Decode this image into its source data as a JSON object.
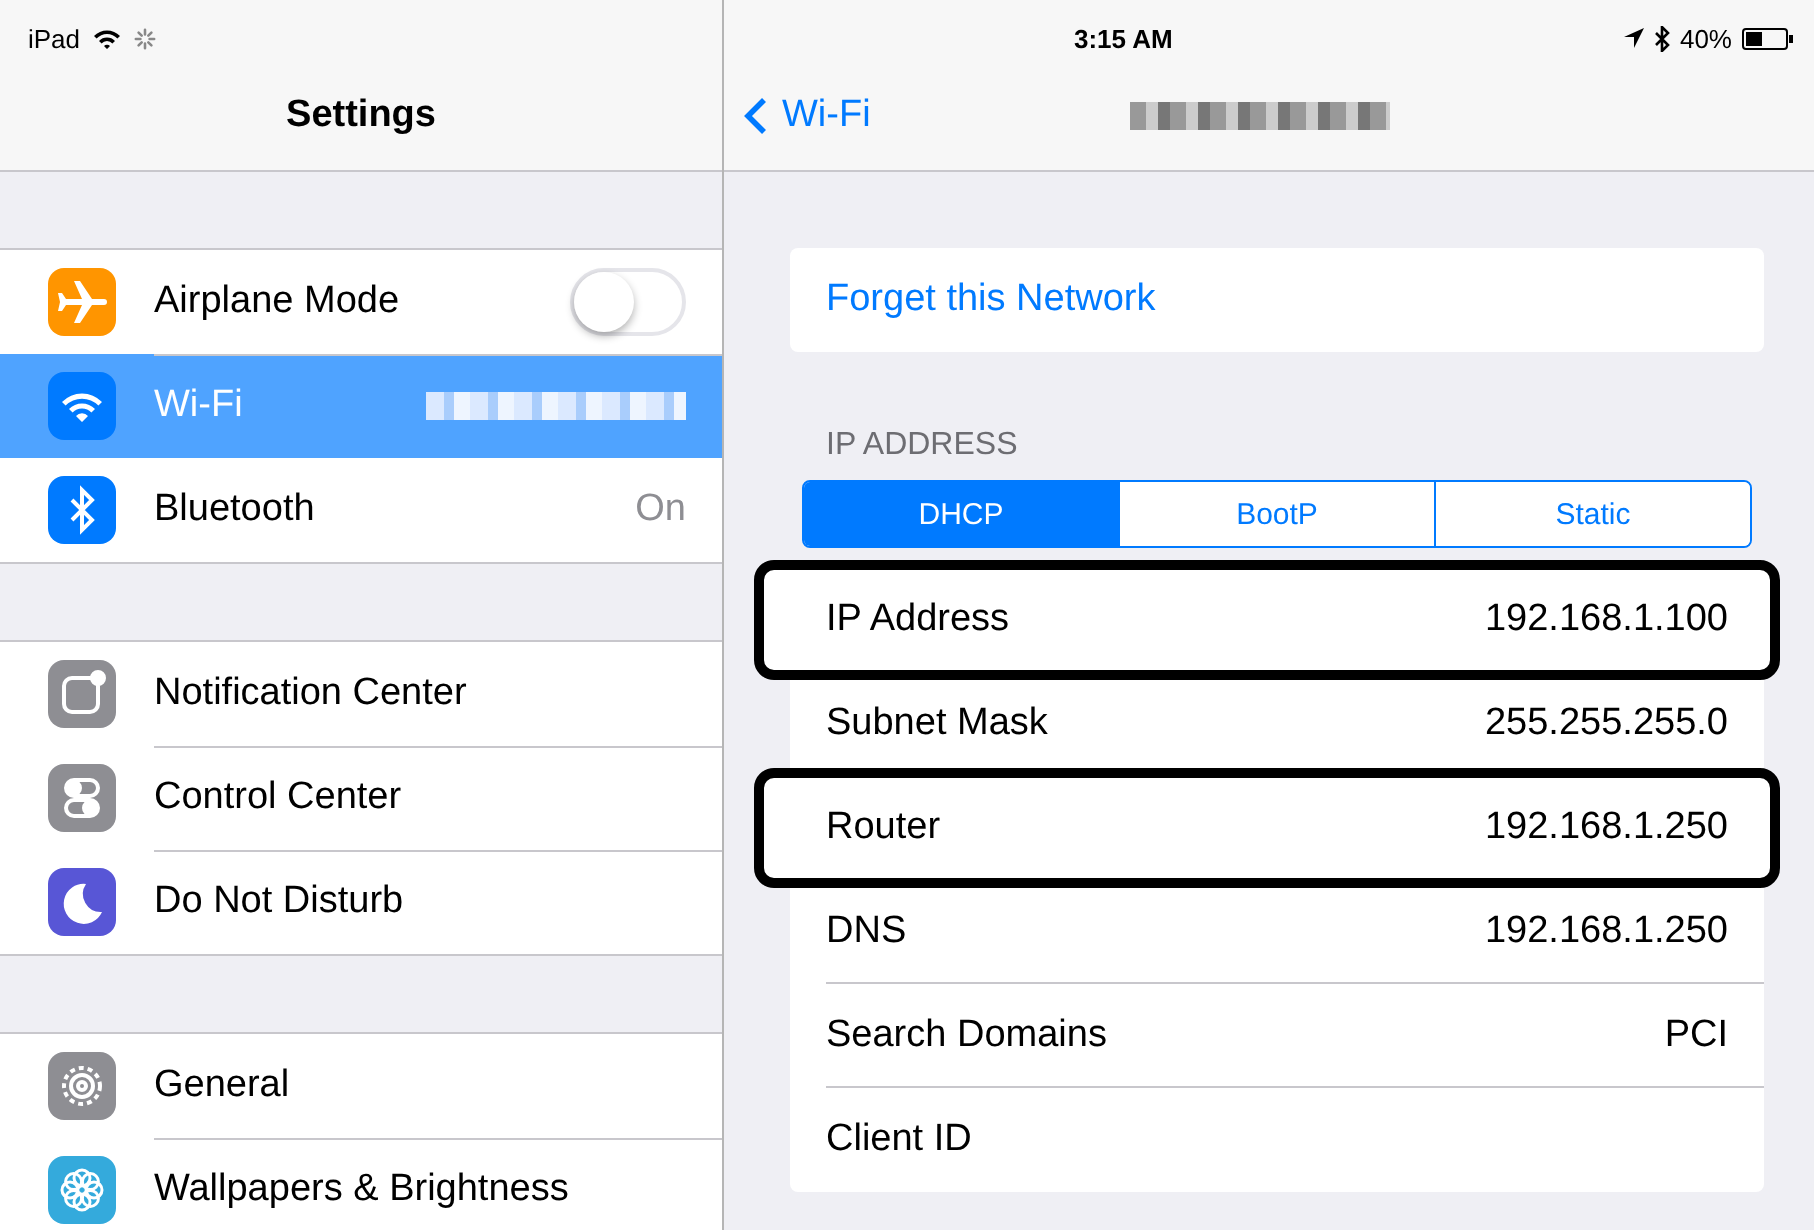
{
  "status_bar": {
    "device": "iPad",
    "time": "3:15 AM",
    "battery": "40%"
  },
  "sidebar": {
    "title": "Settings",
    "groups": [
      [
        {
          "kind": "airplane",
          "color": "#ff9500",
          "label": "Airplane Mode",
          "toggle": {
            "on": false
          },
          "selected": false
        },
        {
          "kind": "wifi",
          "color": "#007aff",
          "label": "Wi-Fi",
          "redacted_detail": true,
          "selected": true
        },
        {
          "kind": "bluetooth",
          "color": "#007aff",
          "label": "Bluetooth",
          "value": "On",
          "selected": false
        }
      ],
      [
        {
          "kind": "notification",
          "color": "#8e8e93",
          "label": "Notification Center",
          "selected": false
        },
        {
          "kind": "control",
          "color": "#8e8e93",
          "label": "Control Center",
          "selected": false
        },
        {
          "kind": "moon",
          "color": "#5856d6",
          "label": "Do Not Disturb",
          "selected": false
        }
      ],
      [
        {
          "kind": "gear",
          "color": "#8e8e93",
          "label": "General",
          "selected": false
        },
        {
          "kind": "flower",
          "color": "#34aadc",
          "label": "Wallpapers & Brightness",
          "selected": false
        }
      ]
    ]
  },
  "detail": {
    "back": "Wi-Fi",
    "title_redacted": true,
    "forget": "Forget this Network",
    "section": "IP ADDRESS",
    "segments": [
      {
        "label": "DHCP",
        "selected": true
      },
      {
        "label": "BootP",
        "selected": false
      },
      {
        "label": "Static",
        "selected": false
      }
    ],
    "rows": [
      {
        "label": "IP Address",
        "value": "192.168.1.100",
        "highlighted": true
      },
      {
        "label": "Subnet Mask",
        "value": "255.255.255.0",
        "highlighted": false
      },
      {
        "label": "Router",
        "value": "192.168.1.250",
        "highlighted": true
      },
      {
        "label": "DNS",
        "value": "192.168.1.250",
        "highlighted": false
      },
      {
        "label": "Search Domains",
        "value": "PCI",
        "highlighted": false
      },
      {
        "label": "Client ID",
        "highlighted": false
      }
    ]
  }
}
